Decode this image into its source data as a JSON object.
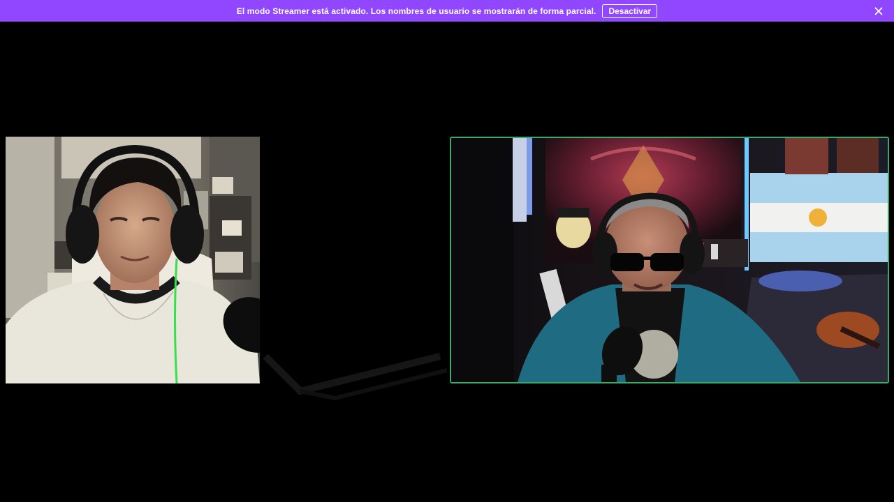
{
  "banner": {
    "message": "El modo Streamer está activado. Los nombres de usuario se mostrarán de forma parcial.",
    "button_label": "Desactivar",
    "close_icon": "close-icon",
    "background": "#9147ff"
  },
  "cams": [
    {
      "id": "participant-1",
      "speaking": false
    },
    {
      "id": "participant-2",
      "speaking": true,
      "highlight_color": "#3ea86b"
    }
  ]
}
